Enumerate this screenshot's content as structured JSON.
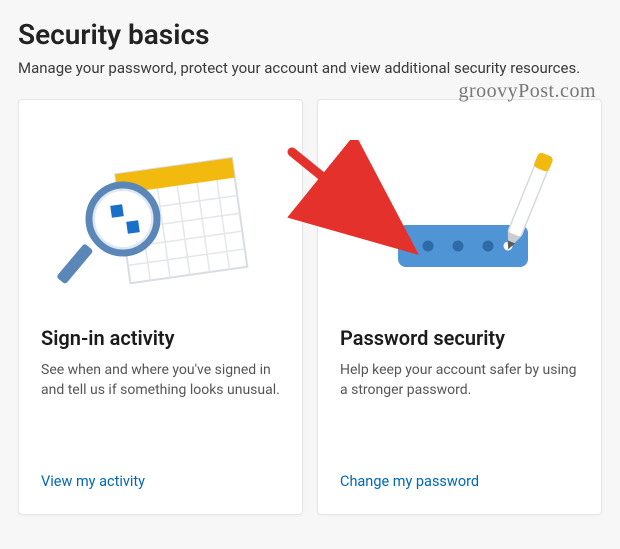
{
  "header": {
    "title": "Security basics",
    "subtitle": "Manage your password, protect your account and view additional security resources."
  },
  "watermark": "groovyPost.com",
  "cards": [
    {
      "title": "Sign-in activity",
      "desc": "See when and where you've signed in and tell us if something looks unusual.",
      "link": "View my activity"
    },
    {
      "title": "Password security",
      "desc": "Help keep your account safer by using a stronger password.",
      "link": "Change my password"
    }
  ]
}
